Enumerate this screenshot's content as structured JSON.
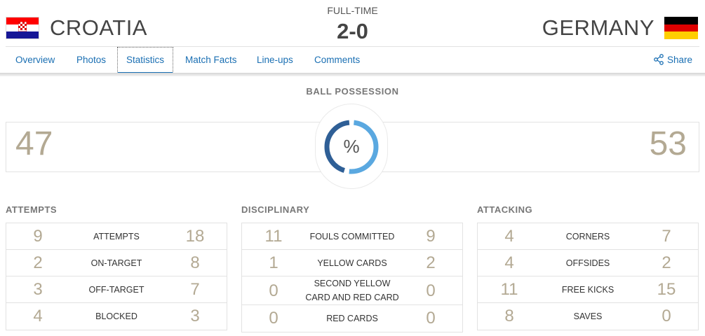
{
  "match": {
    "status": "FULL-TIME",
    "score": "2-0",
    "home": {
      "name": "CROATIA",
      "flag_icon": "croatia-flag-icon",
      "flag_colors": [
        "#ff0000",
        "#ffffff",
        "#171796"
      ]
    },
    "away": {
      "name": "GERMANY",
      "flag_icon": "germany-flag-icon",
      "flag_colors": [
        "#000000",
        "#dd0000",
        "#ffce00"
      ]
    }
  },
  "tabs": [
    {
      "label": "Overview",
      "active": false
    },
    {
      "label": "Photos",
      "active": false
    },
    {
      "label": "Statistics",
      "active": true
    },
    {
      "label": "Match Facts",
      "active": false
    },
    {
      "label": "Line-ups",
      "active": false
    },
    {
      "label": "Comments",
      "active": false
    }
  ],
  "share": {
    "label": "Share",
    "icon": "share-icon"
  },
  "possession": {
    "title": "BALL POSSESSION",
    "home": "47",
    "away": "53",
    "symbol": "%",
    "home_fraction": 0.47,
    "away_fraction": 0.53,
    "home_color": "#2f5f96",
    "away_color": "#5aa8e0"
  },
  "sections": [
    {
      "title": "ATTEMPTS",
      "rows": [
        {
          "label": "ATTEMPTS",
          "home": "9",
          "away": "18"
        },
        {
          "label": "ON-TARGET",
          "home": "2",
          "away": "8"
        },
        {
          "label": "OFF-TARGET",
          "home": "3",
          "away": "7"
        },
        {
          "label": "BLOCKED",
          "home": "4",
          "away": "3"
        }
      ]
    },
    {
      "title": "DISCIPLINARY",
      "rows": [
        {
          "label": "FOULS COMMITTED",
          "home": "11",
          "away": "9"
        },
        {
          "label": "YELLOW CARDS",
          "home": "1",
          "away": "2"
        },
        {
          "label": "SECOND YELLOW CARD AND RED CARD",
          "home": "0",
          "away": "0"
        },
        {
          "label": "RED CARDS",
          "home": "0",
          "away": "0"
        }
      ]
    },
    {
      "title": "ATTACKING",
      "rows": [
        {
          "label": "CORNERS",
          "home": "4",
          "away": "7"
        },
        {
          "label": "OFFSIDES",
          "home": "4",
          "away": "2"
        },
        {
          "label": "FREE KICKS",
          "home": "11",
          "away": "15"
        },
        {
          "label": "SAVES",
          "home": "8",
          "away": "0"
        }
      ]
    }
  ]
}
